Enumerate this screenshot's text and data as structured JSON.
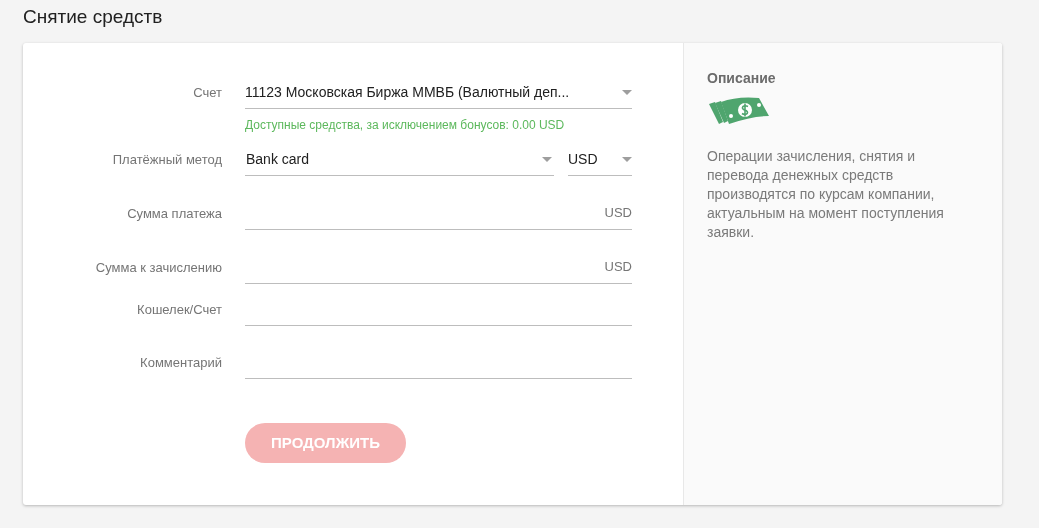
{
  "page_title": "Снятие средств",
  "fields": [
    {
      "kind": "select",
      "label": "Счет",
      "value": "11123 Московская Биржа ММВБ (Валютный деп...",
      "hint": "Доступные средства, за исключением бонусов: 0.00 USD"
    },
    {
      "kind": "select-pair",
      "label": "Платёжный метод",
      "value": "Bank card",
      "currency": "USD"
    },
    {
      "kind": "amount",
      "label": "Сумма платежа",
      "suffix": "USD"
    },
    {
      "kind": "amount",
      "label": "Сумма к зачислению",
      "suffix": "USD"
    },
    {
      "kind": "text",
      "label": "Кошелек/Счет"
    },
    {
      "kind": "text",
      "label": "Комментарий"
    }
  ],
  "continue_button": {
    "label": "ПРОДОЛЖИТЬ",
    "disabled": true
  },
  "description": {
    "title": "Описание",
    "text": "Операции зачисления, снятия и перевода денежных средств производятся по курсам компании, актуальным на момент поступления заявки."
  }
}
